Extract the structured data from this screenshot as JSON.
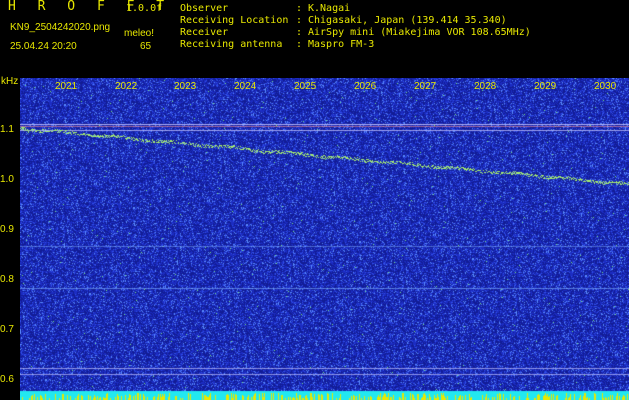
{
  "header": {
    "app_title": "H R O F F T",
    "fft_resolution": "1.0.0f",
    "filename": "KN9_2504242020.png",
    "meleo_label": "meleo!",
    "timestamp": "25.04.24 20:20",
    "meleo_value": "65",
    "info": [
      {
        "label": "Observer",
        "value": "K.Nagai"
      },
      {
        "label": "Receiving Location",
        "value": "Chigasaki, Japan (139.414 35.340)"
      },
      {
        "label": "Receiver",
        "value": "AirSpy mini (Miakejima VOR 108.65MHz)"
      },
      {
        "label": "Receiving antenna",
        "value": "Maspro FM-3"
      }
    ]
  },
  "plot": {
    "unit": "kHz",
    "y_ticks": [
      "1.1",
      "1.0",
      "0.9",
      "0.8",
      "0.7",
      "0.6"
    ],
    "x_ticks": [
      "2021",
      "2022",
      "2023",
      "2024",
      "2025",
      "2026",
      "2027",
      "2028",
      "2029",
      "2030"
    ],
    "colors": {
      "background": "#1a28b8",
      "noise": "#3a60f0",
      "trace": "#a8f070",
      "text": "#e8e800",
      "bottom_bar": "#22e8f0"
    }
  }
}
